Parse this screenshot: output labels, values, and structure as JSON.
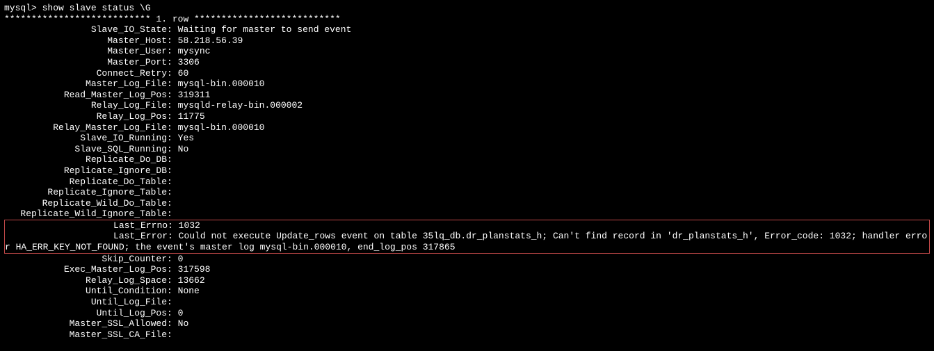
{
  "prompt": "mysql> show slave status \\G",
  "row_header": "*************************** 1. row ***************************",
  "label_col_width": 30,
  "highlight_start_index": 17,
  "highlight_end_index": 18,
  "rows": [
    {
      "label": "Slave_IO_State",
      "value": "Waiting for master to send event"
    },
    {
      "label": "Master_Host",
      "value": "58.218.56.39"
    },
    {
      "label": "Master_User",
      "value": "mysync"
    },
    {
      "label": "Master_Port",
      "value": "3306"
    },
    {
      "label": "Connect_Retry",
      "value": "60"
    },
    {
      "label": "Master_Log_File",
      "value": "mysql-bin.000010"
    },
    {
      "label": "Read_Master_Log_Pos",
      "value": "319311"
    },
    {
      "label": "Relay_Log_File",
      "value": "mysqld-relay-bin.000002"
    },
    {
      "label": "Relay_Log_Pos",
      "value": "11775"
    },
    {
      "label": "Relay_Master_Log_File",
      "value": "mysql-bin.000010"
    },
    {
      "label": "Slave_IO_Running",
      "value": "Yes"
    },
    {
      "label": "Slave_SQL_Running",
      "value": "No"
    },
    {
      "label": "Replicate_Do_DB",
      "value": ""
    },
    {
      "label": "Replicate_Ignore_DB",
      "value": ""
    },
    {
      "label": "Replicate_Do_Table",
      "value": ""
    },
    {
      "label": "Replicate_Ignore_Table",
      "value": ""
    },
    {
      "label": "Replicate_Wild_Do_Table",
      "value": ""
    },
    {
      "label": "Replicate_Wild_Ignore_Table",
      "value": ""
    },
    {
      "label": "Last_Errno",
      "value": "1032"
    },
    {
      "label": "Last_Error",
      "value": "Could not execute Update_rows event on table 35lq_db.dr_planstats_h; Can't find record in 'dr_planstats_h', Error_code: 1032; handler error HA_ERR_KEY_NOT_FOUND; the event's master log mysql-bin.000010, end_log_pos 317865"
    },
    {
      "label": "Skip_Counter",
      "value": "0"
    },
    {
      "label": "Exec_Master_Log_Pos",
      "value": "317598"
    },
    {
      "label": "Relay_Log_Space",
      "value": "13662"
    },
    {
      "label": "Until_Condition",
      "value": "None"
    },
    {
      "label": "Until_Log_File",
      "value": ""
    },
    {
      "label": "Until_Log_Pos",
      "value": "0"
    },
    {
      "label": "Master_SSL_Allowed",
      "value": "No"
    },
    {
      "label": "Master_SSL_CA_File",
      "value": ""
    }
  ]
}
